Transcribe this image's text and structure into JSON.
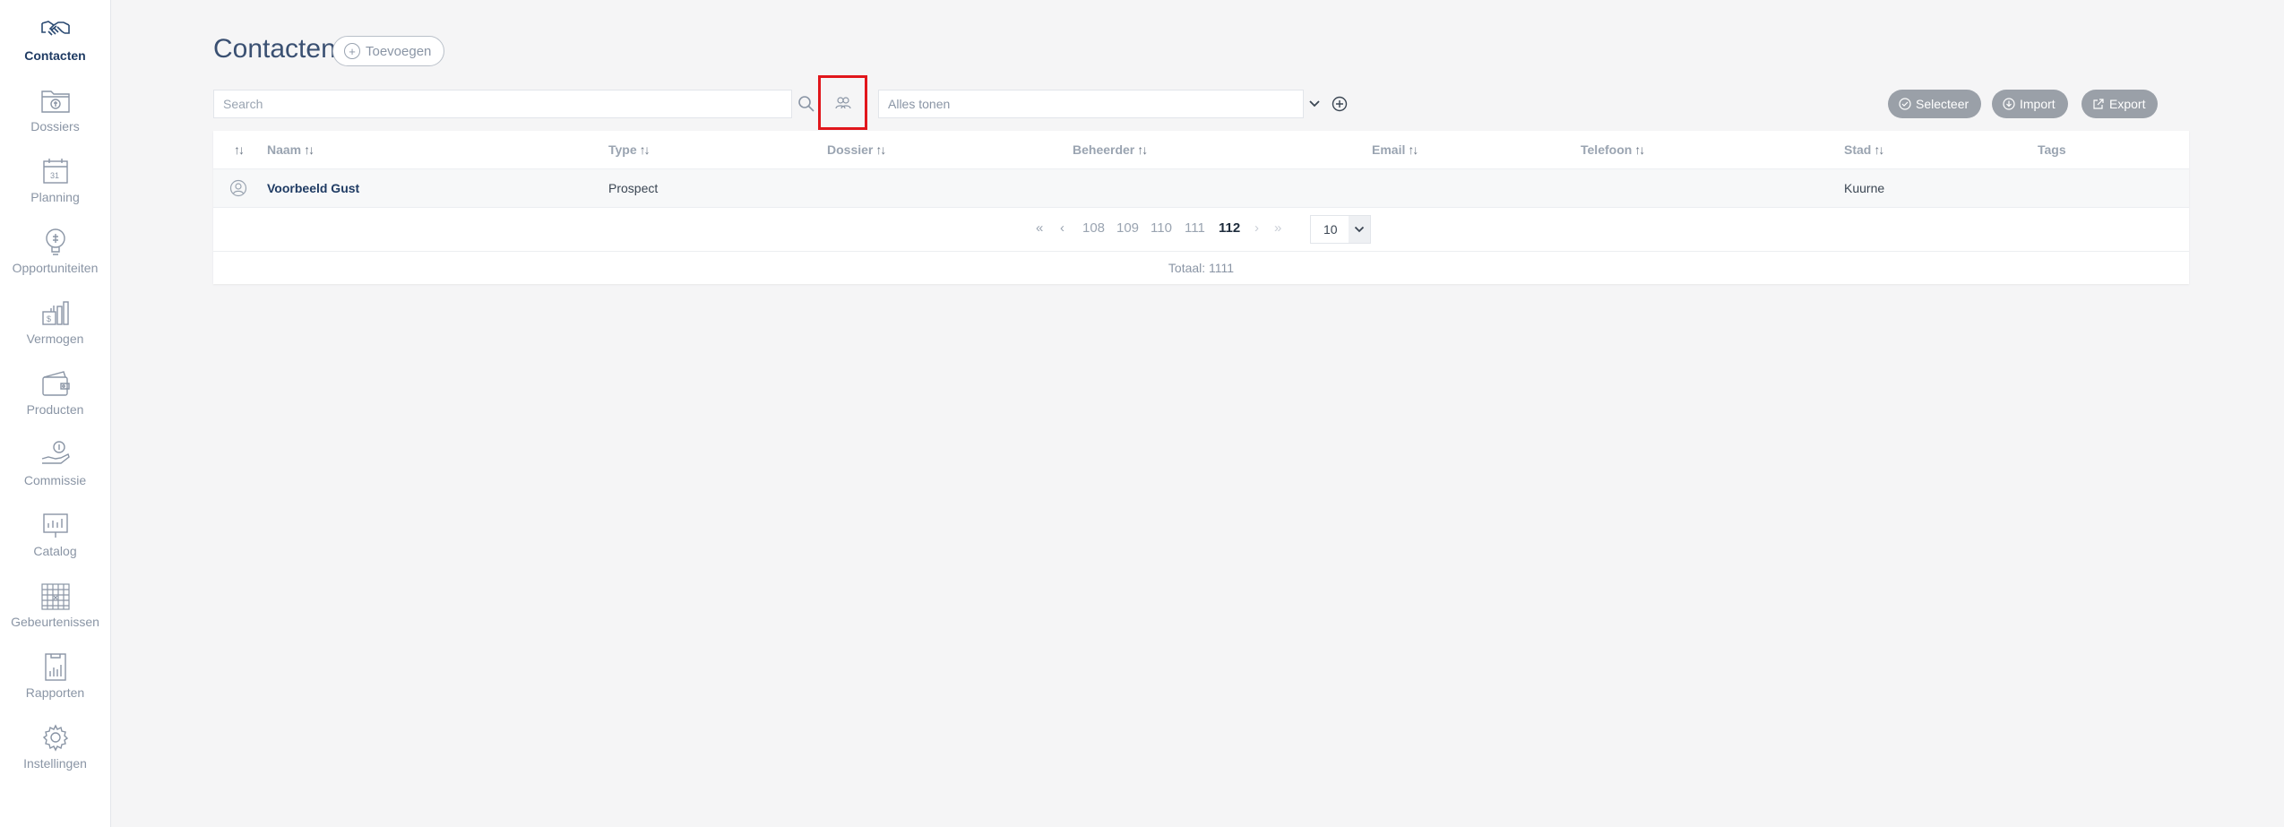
{
  "sidebar": {
    "items": [
      {
        "label": "Contacten",
        "icon": "handshake-icon",
        "active": true
      },
      {
        "label": "Dossiers",
        "icon": "folder-icon"
      },
      {
        "label": "Planning",
        "icon": "calendar-icon"
      },
      {
        "label": "Opportuniteiten",
        "icon": "lightbulb-icon"
      },
      {
        "label": "Vermogen",
        "icon": "money-stack-icon"
      },
      {
        "label": "Producten",
        "icon": "wallet-icon"
      },
      {
        "label": "Commissie",
        "icon": "hand-coin-icon"
      },
      {
        "label": "Catalog",
        "icon": "catalog-board-icon"
      },
      {
        "label": "Gebeurtenissen",
        "icon": "calendar-grid-icon"
      },
      {
        "label": "Rapporten",
        "icon": "report-icon"
      },
      {
        "label": "Instellingen",
        "icon": "gear-icon"
      }
    ]
  },
  "header": {
    "title": "Contacten",
    "add_label": "Toevoegen"
  },
  "toolbar": {
    "search_placeholder": "Search",
    "filter_placeholder": "Alles tonen",
    "selecteer_label": "Selecteer",
    "import_label": "Import",
    "export_label": "Export"
  },
  "table": {
    "columns": [
      "Naam",
      "Type",
      "Dossier",
      "Beheerder",
      "Email",
      "Telefoon",
      "Stad",
      "Tags"
    ],
    "rows": [
      {
        "naam": "Voorbeeld Gust",
        "type": "Prospect",
        "dossier": "",
        "beheerder": "",
        "email": "",
        "telefoon": "",
        "stad": "Kuurne",
        "tags": ""
      }
    ]
  },
  "pagination": {
    "first": "«",
    "prev": "‹",
    "pages": [
      "108",
      "109",
      "110",
      "111",
      "112"
    ],
    "current": "112",
    "next": "›",
    "last": "»",
    "per_page": "10",
    "total_label": "Totaal: 1111"
  },
  "colors": {
    "accent": "#1f3b63",
    "highlight_border": "#e1161c",
    "pill_bg": "#9aa0a8"
  }
}
